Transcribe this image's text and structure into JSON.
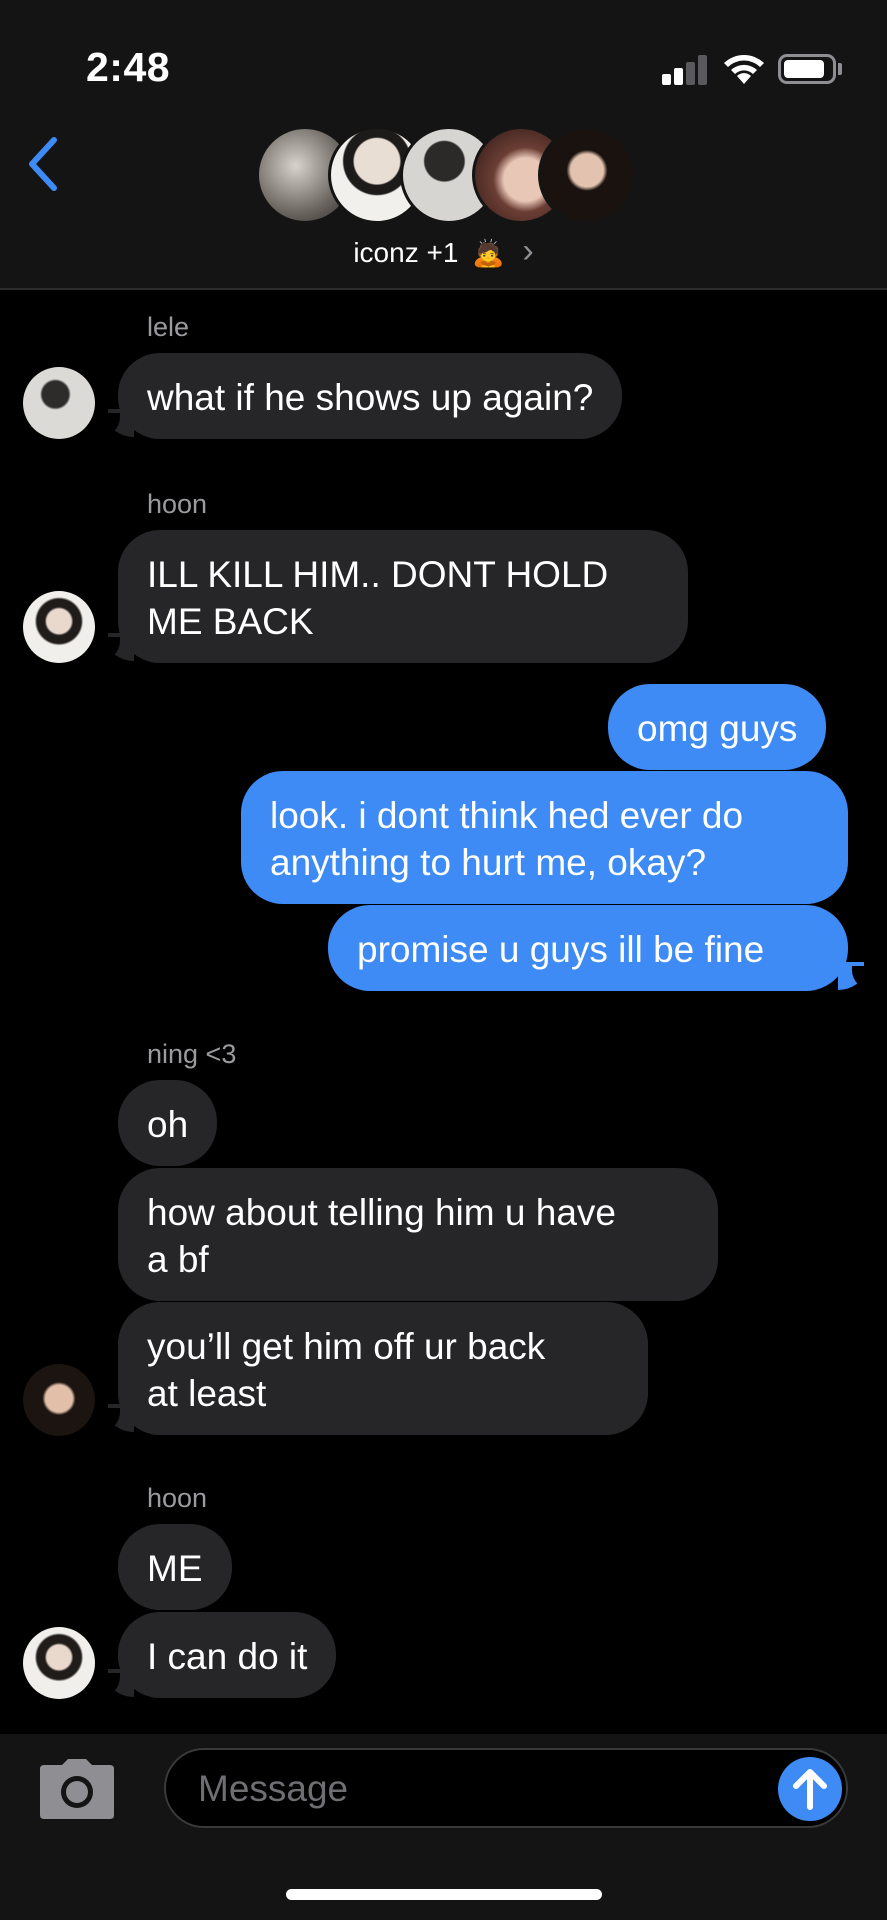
{
  "status_bar": {
    "time": "2:48"
  },
  "header": {
    "group_name": "iconz +1",
    "group_emoji": "🙇",
    "chevron": "›",
    "icons": {
      "back": "chevron-left-icon",
      "details": "chevron-right-icon"
    }
  },
  "messages": [
    {
      "sender": "lele",
      "text": "what if he shows up again?",
      "direction": "in"
    },
    {
      "sender": "hoon",
      "text": "ILL KILL HIM.. DONT HOLD\nME BACK",
      "direction": "in"
    },
    {
      "sender": "",
      "text": "omg guys",
      "direction": "out"
    },
    {
      "sender": "",
      "text": "look. i dont think hed ever do\nanything to hurt me, okay?",
      "direction": "out"
    },
    {
      "sender": "",
      "text": "promise u guys ill be fine",
      "direction": "out"
    },
    {
      "sender": "ning <3",
      "text": "oh",
      "direction": "in"
    },
    {
      "sender": "",
      "text": "how about telling him u have\na bf",
      "direction": "in"
    },
    {
      "sender": "",
      "text": "you’ll get him off ur back\nat least",
      "direction": "in"
    },
    {
      "sender": "hoon",
      "text": "ME",
      "direction": "in"
    },
    {
      "sender": "",
      "text": "I can do it",
      "direction": "in"
    }
  ],
  "composer": {
    "placeholder": "Message",
    "icons": {
      "camera": "camera-icon",
      "send": "arrow-up-icon"
    }
  },
  "colors": {
    "accent": "#3e8bf6",
    "incoming_bubble": "#262629",
    "background": "#000000",
    "header_bg": "#141414"
  }
}
